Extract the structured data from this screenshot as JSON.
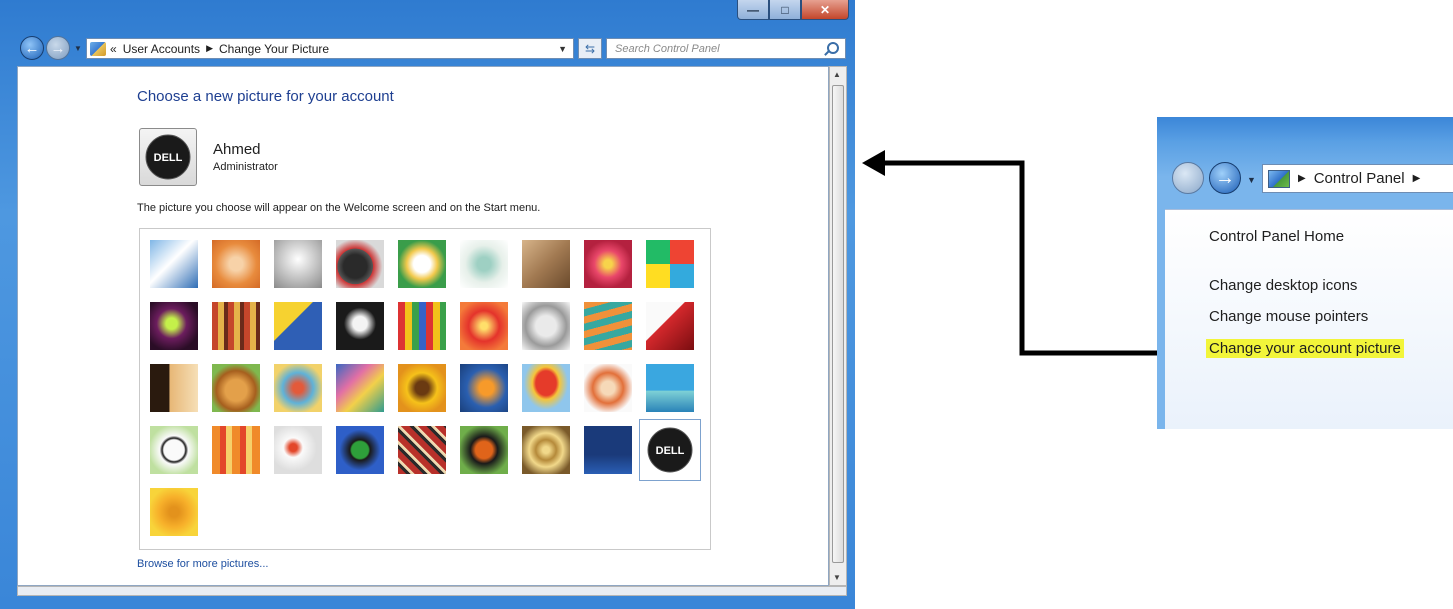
{
  "window": {
    "minimize_label": "—",
    "maximize_label": "□",
    "close_label": "✕",
    "address": {
      "overflow": "«",
      "crumbs": [
        "User Accounts",
        "Change Your Picture"
      ]
    },
    "search_placeholder": "Search Control Panel"
  },
  "main": {
    "heading": "Choose a new picture for your account",
    "user_name": "Ahmed",
    "user_role": "Administrator",
    "description": "The picture you choose will appear on the Welcome screen and on the Start menu.",
    "browse_link": "Browse for more pictures...",
    "avatar_logo_text": "DELL",
    "pictures": [
      "ferris-wheel",
      "starfish",
      "robot-toy",
      "record-player",
      "lucky-cat",
      "gyroscope",
      "kitten",
      "pink-flower",
      "pinwheel",
      "green-ball",
      "fabric",
      "yellow-leaf",
      "dog",
      "crayons",
      "red-star",
      "jacks",
      "stairs",
      "paper-crane",
      "guitar",
      "puppy",
      "tin-robot",
      "scarves",
      "sunflower",
      "fish",
      "hot-air-balloon",
      "doll",
      "sailboat",
      "soccer-ball",
      "stripes",
      "marbles",
      "window",
      "textile",
      "butterfly",
      "basket",
      "lighthouse",
      "dell-logo",
      "daisy"
    ],
    "selected_picture": "dell-logo"
  },
  "zoom_inset": {
    "address_label": "Control Panel",
    "links": [
      "Control Panel Home",
      "Change desktop icons",
      "Change mouse pointers",
      "Change your account picture"
    ],
    "highlighted_link": "Change your account picture",
    "highlight_color": "#f2f53a"
  },
  "colors": {
    "heading": "#1e3f91",
    "link": "#1e4fa0",
    "titlebar": "#2f7bd0"
  }
}
